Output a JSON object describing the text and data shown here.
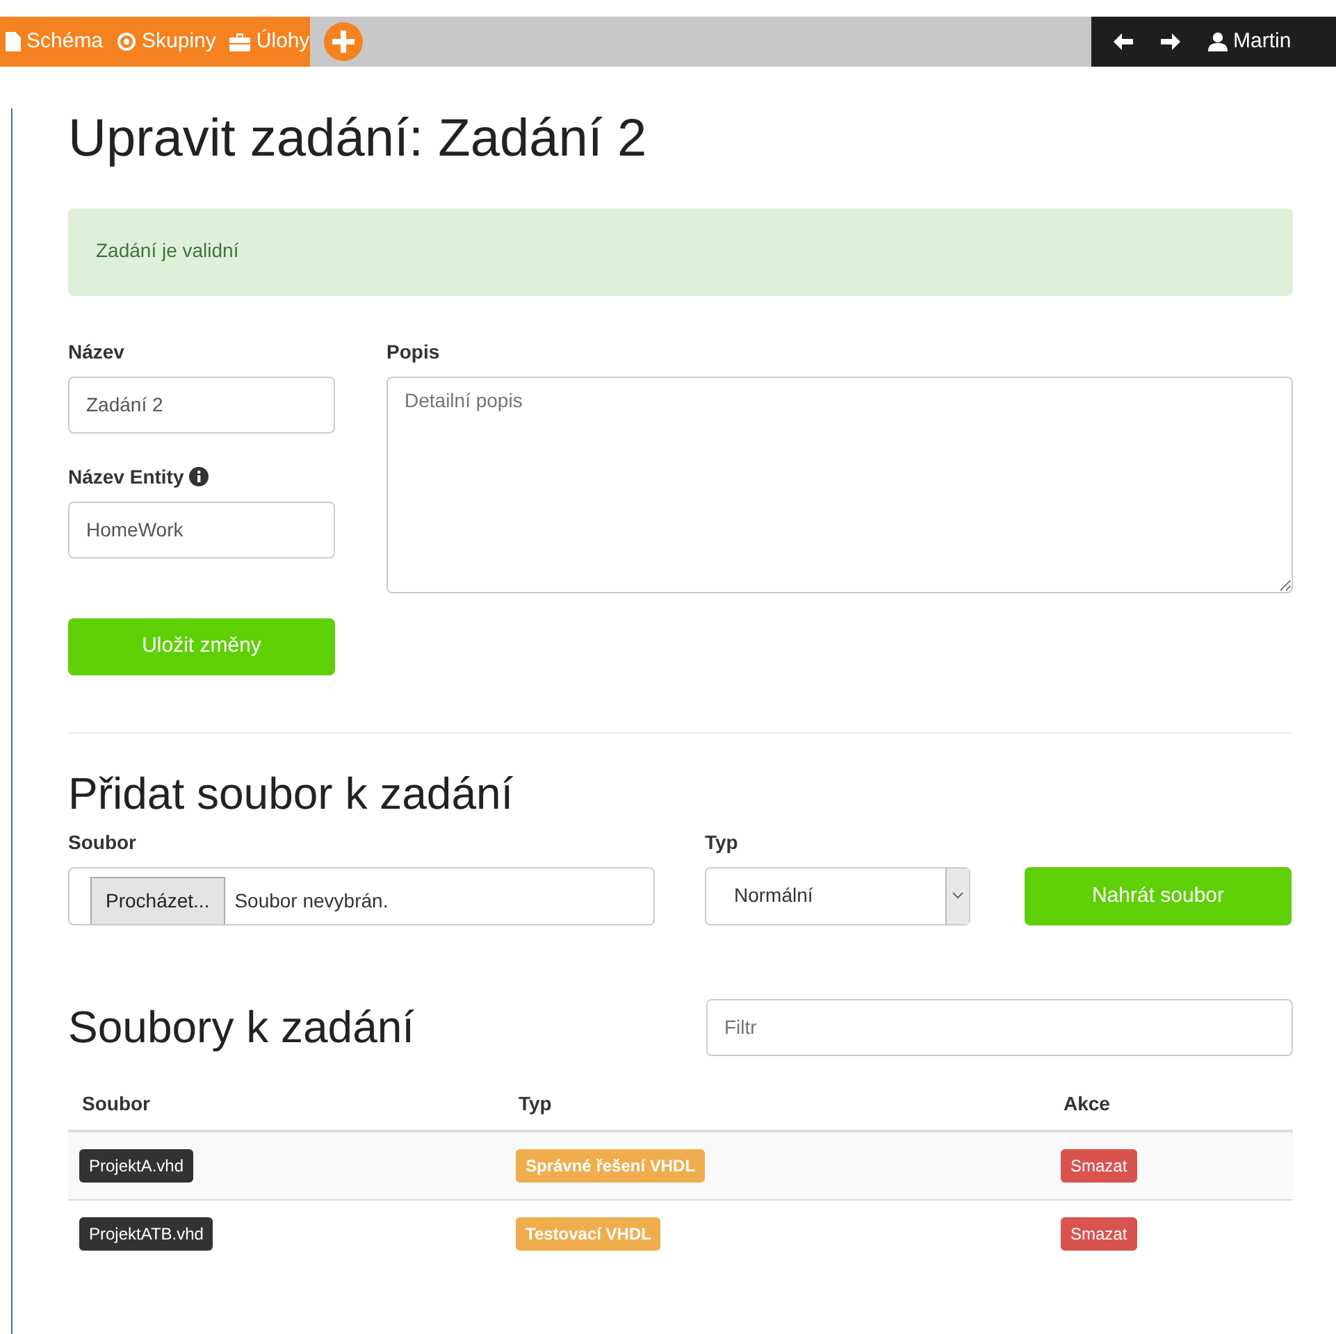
{
  "navbar": {
    "left": [
      {
        "kind": "file",
        "label": "Schéma"
      },
      {
        "kind": "target",
        "label": "Skupiny"
      },
      {
        "kind": "briefcase",
        "label": "Úlohy"
      },
      {
        "kind": "add"
      }
    ],
    "right": [
      {
        "kind": "back"
      },
      {
        "kind": "forward"
      },
      {
        "kind": "user",
        "label": "Martin"
      }
    ]
  },
  "title": "Upravit zadání: Zadání 2",
  "alert": "Zadání je validní",
  "form": {
    "name_label": "Název",
    "name_value": "Zadání 2",
    "entity_label": "Název Entity",
    "entity_value": "HomeWork",
    "desc_label": "Popis",
    "desc_placeholder": "Detailní popis",
    "save": "Uložit změny"
  },
  "upload": {
    "heading": "Přidat soubor k zadání",
    "file_label": "Soubor",
    "browse": "Procházet...",
    "no_file": "Soubor nevybrán.",
    "type_label": "Typ",
    "type_value": "Normální",
    "submit": "Nahrát soubor"
  },
  "files": {
    "heading": "Soubory k zadání",
    "filter_placeholder": "Filtr",
    "columns": [
      "Soubor",
      "Typ",
      "Akce"
    ],
    "rows": [
      {
        "file": "ProjektA.vhd",
        "type": "Správné řešení VHDL",
        "action": "Smazat"
      },
      {
        "file": "ProjektATB.vhd",
        "type": "Testovací VHDL",
        "action": "Smazat"
      }
    ]
  }
}
